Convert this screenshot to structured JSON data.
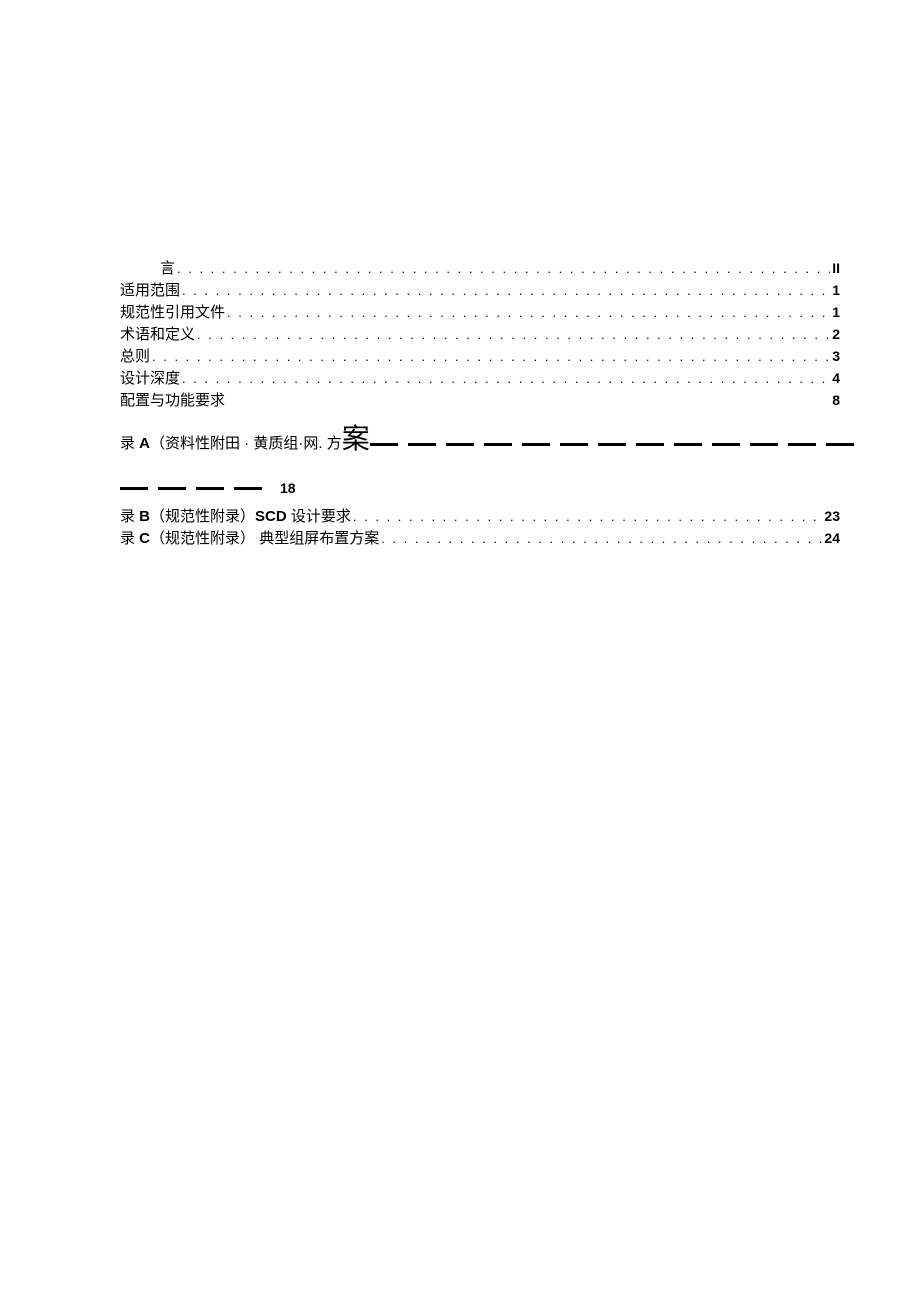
{
  "toc": {
    "entries": [
      {
        "label": "言",
        "page": "II",
        "indent": true,
        "dots": true
      },
      {
        "label": "适用范围",
        "page": "1",
        "dots": true
      },
      {
        "label": "规范性引用文件",
        "page": "1",
        "dots": true
      },
      {
        "label": "术语和定义",
        "page": "2",
        "dots": true
      },
      {
        "label": "总则",
        "page": "3",
        "dots": true
      },
      {
        "label": "设计深度",
        "page": "4",
        "dots": true
      },
      {
        "label": "配置与功能要求",
        "page": "8",
        "dots": false
      }
    ],
    "appendix_a": {
      "prefix": "录 ",
      "letter": "A",
      "paren_text": "（资料性附田 · 黄质组·网. 方",
      "big_char": "案",
      "page": "18"
    },
    "appendix_b": {
      "prefix": "录 ",
      "letter": "B",
      "paren_text": "（规范性附录）",
      "tail": "SCD 设计要求",
      "page": "23"
    },
    "appendix_c": {
      "prefix": "录 ",
      "letter": "C",
      "paren_text": "（规范性附录）",
      "tail": " 典型组屏布置方案",
      "page": "24"
    }
  }
}
